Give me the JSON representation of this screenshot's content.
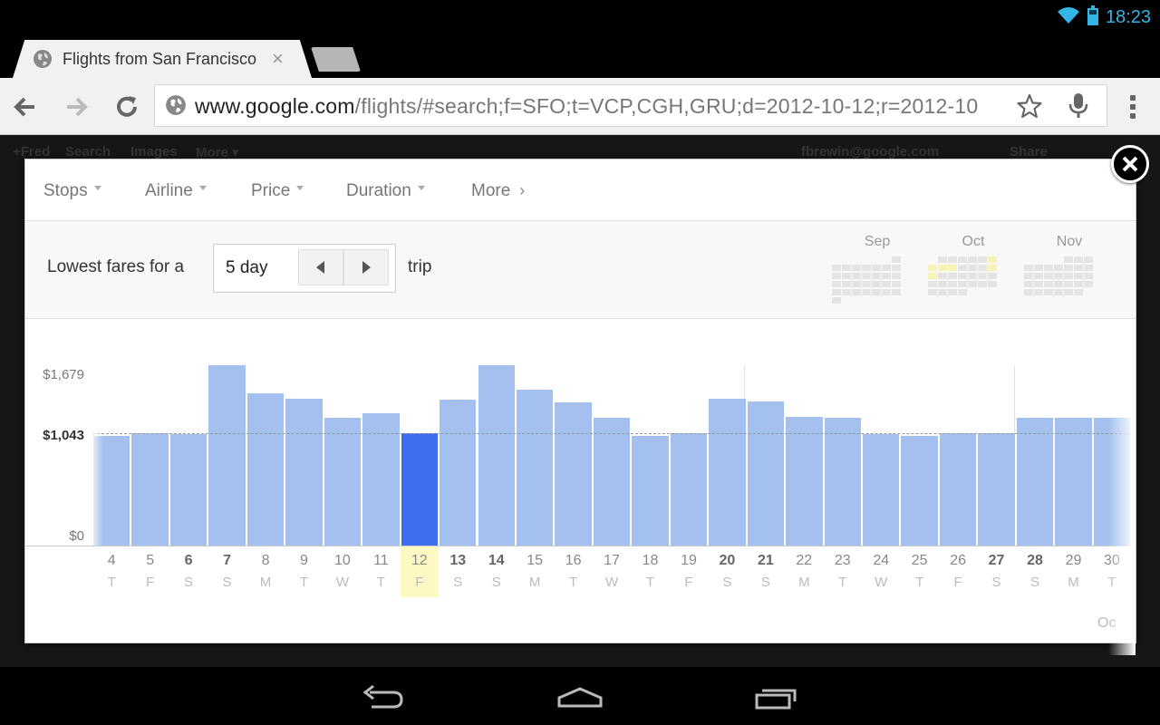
{
  "status": {
    "time": "18:23"
  },
  "browser": {
    "tab_title": "Flights from San Francisco",
    "tab_close": "×",
    "url_host": "www.google.com",
    "url_path": "/flights/#search;f=SFO;t=VCP,CGH,GRU;d=2012-10-12;r=2012-10"
  },
  "page_ghost": {
    "items": [
      "+Fred",
      "Search",
      "Images",
      "More ▾"
    ],
    "account": "fbrewin@google.com",
    "share": "Share"
  },
  "filters": [
    {
      "label": "Stops",
      "kind": "dropdown"
    },
    {
      "label": "Airline",
      "kind": "dropdown"
    },
    {
      "label": "Price",
      "kind": "dropdown"
    },
    {
      "label": "Duration",
      "kind": "dropdown"
    },
    {
      "label": "More",
      "kind": "next"
    }
  ],
  "trip": {
    "prefix": "Lowest fares for a",
    "length": "5 day",
    "suffix": "trip"
  },
  "mini_calendar": {
    "months": [
      "Sep",
      "Oct",
      "Nov"
    ]
  },
  "chart_data": {
    "type": "bar",
    "y_ticks": [
      "$1,679",
      "$1,043",
      "$0"
    ],
    "y_values": [
      1679,
      1043,
      0
    ],
    "reference_label": "$1,043",
    "reference_value": 1043,
    "ylim": [
      0,
      1679
    ],
    "selected_index": 8,
    "days": [
      {
        "d": "4",
        "w": "T",
        "bold": false
      },
      {
        "d": "5",
        "w": "F",
        "bold": false
      },
      {
        "d": "6",
        "w": "S",
        "bold": true
      },
      {
        "d": "7",
        "w": "S",
        "bold": true
      },
      {
        "d": "8",
        "w": "M",
        "bold": false
      },
      {
        "d": "9",
        "w": "T",
        "bold": false
      },
      {
        "d": "10",
        "w": "W",
        "bold": false
      },
      {
        "d": "11",
        "w": "T",
        "bold": false
      },
      {
        "d": "12",
        "w": "F",
        "bold": false
      },
      {
        "d": "13",
        "w": "S",
        "bold": true
      },
      {
        "d": "14",
        "w": "S",
        "bold": true
      },
      {
        "d": "15",
        "w": "M",
        "bold": false
      },
      {
        "d": "16",
        "w": "T",
        "bold": false
      },
      {
        "d": "17",
        "w": "W",
        "bold": false
      },
      {
        "d": "18",
        "w": "T",
        "bold": false
      },
      {
        "d": "19",
        "w": "F",
        "bold": false
      },
      {
        "d": "20",
        "w": "S",
        "bold": true
      },
      {
        "d": "21",
        "w": "S",
        "bold": true
      },
      {
        "d": "22",
        "w": "M",
        "bold": false
      },
      {
        "d": "23",
        "w": "T",
        "bold": false
      },
      {
        "d": "24",
        "w": "W",
        "bold": false
      },
      {
        "d": "25",
        "w": "T",
        "bold": false
      },
      {
        "d": "26",
        "w": "F",
        "bold": false
      },
      {
        "d": "27",
        "w": "S",
        "bold": true
      },
      {
        "d": "28",
        "w": "S",
        "bold": true
      },
      {
        "d": "29",
        "w": "M",
        "bold": false
      },
      {
        "d": "30",
        "w": "T",
        "bold": false
      }
    ],
    "values": [
      1020,
      1043,
      1035,
      1679,
      1420,
      1370,
      1190,
      1230,
      1043,
      1360,
      1679,
      1450,
      1330,
      1190,
      1020,
      1043,
      1370,
      1340,
      1200,
      1190,
      1040,
      1020,
      1043,
      1043,
      1190,
      1190,
      1190
    ],
    "month_mark": "Oct",
    "bar_color": "#a4c0ef",
    "selected_color": "#3d6ef0",
    "selected_highlight": "#fdf9c4"
  }
}
